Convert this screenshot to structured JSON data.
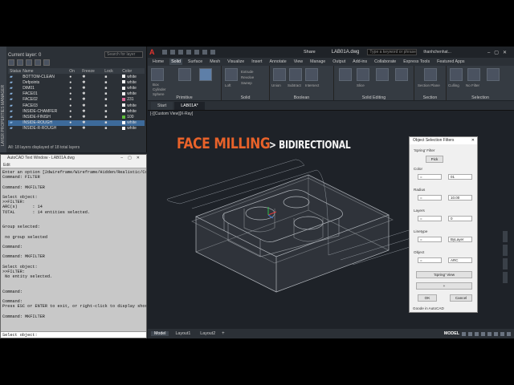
{
  "layers": {
    "panel_label": "LAYER PROPERTIES MANAGER",
    "current_layer": "Current layer: 0",
    "search_placeholder": "Search for layer",
    "columns": [
      "Status",
      "Name",
      "On",
      "Freeze",
      "Lock",
      "Color"
    ],
    "rows": [
      {
        "name": "BOTTOM-CLEAN",
        "color": "white",
        "swatch": "#ffffff"
      },
      {
        "name": "Defpoints",
        "color": "white",
        "swatch": "#ffffff"
      },
      {
        "name": "DIM01",
        "color": "white",
        "swatch": "#ffffff"
      },
      {
        "name": "FACE01",
        "color": "white",
        "swatch": "#ffffff"
      },
      {
        "name": "FACE02",
        "color": "231",
        "swatch": "#e06a9a"
      },
      {
        "name": "FACE03",
        "color": "white",
        "swatch": "#ffffff"
      },
      {
        "name": "INSIDE-CHAMFER",
        "color": "white",
        "swatch": "#ffffff"
      },
      {
        "name": "INSIDE-FINISH",
        "color": "100",
        "swatch": "#5fbf3a"
      },
      {
        "name": "INSIDE-ROUGH",
        "color": "white",
        "swatch": "#ffffff"
      },
      {
        "name": "INSIDE-R-ROUGH",
        "color": "white",
        "swatch": "#ffffff"
      }
    ],
    "footer": "All: 18 layers displayed of 18 total layers"
  },
  "textwin": {
    "title": "AutoCAD Text Window - LAB01A.dwg",
    "menu_edit": "Edit",
    "log": "Enter an option [2dwireframe/Wireframe/Hidden/Realistic/Cor\nCommand: FILTER\n\nCommand: MKFILTER\n\nSelect object:\n>>FILTER:\nARC(s)      : 14\nTOTAL       : 14 entities selected.\n\n\nGroup selected:\n\n no group selected\n\nCommand:\n\nCommand: MKFILTER\n\nSelect object:\n>>FILTER:\n No entity selected.\n\n\nCommand:\n\nCommand:\nPress ESC or ENTER to exit, or right-click to display shor\n\nCommand: MKFILTER\n",
    "prompt": "Select object:"
  },
  "app": {
    "logo": "A",
    "share": "Share",
    "doc_title": "LAB01A.dwg",
    "search_placeholder": "Type a keyword or phrase",
    "user": "thanhchenhat..."
  },
  "ribbon": {
    "tabs": [
      "Home",
      "Solid",
      "Surface",
      "Mesh",
      "Visualize",
      "Insert",
      "Annotate",
      "View",
      "Manage",
      "Output",
      "Add-ins",
      "Collaborate",
      "Express Tools",
      "Featured Apps"
    ],
    "active_tab": "Solid",
    "panels": {
      "primitive": "Primitive",
      "solid": "Solid",
      "boolean": "Boolean",
      "solid_editing": "Solid Editing",
      "section": "Section",
      "selection": "Selection"
    },
    "mini": {
      "box": "Box",
      "cylinder": "Cylinder",
      "sphere": "Sphere",
      "extrude": "Extrude",
      "revolve": "Revolve",
      "sweep": "Sweep",
      "loft": "Loft",
      "union": "Union",
      "subtract": "Subtract",
      "intersect": "Intersect",
      "slice": "Slice",
      "section_plane": "Section Plane",
      "culling": "Culling",
      "no_filter": "No Filter"
    }
  },
  "doctabs": [
    "Start",
    "LAB01A*"
  ],
  "viewport": {
    "label": "[-][Custom View][X-Ray]",
    "headline_main": "FACE MILLING",
    "headline_sub": "> BIDIRECTIONAL"
  },
  "dialog": {
    "title": "Object Selection Filters",
    "spring_filter": "'Spring' Filter",
    "pick": "Pick",
    "color_label": "Color",
    "color_op": "=",
    "color_value": "01",
    "radius_label": "Radius",
    "radius_op": "=",
    "radius_value": "10.00",
    "layers_label": "Layers",
    "layers_op": "=",
    "layers_value": "0",
    "linetype_label": "Linetype",
    "linetype_op": "=",
    "linetype_value": "ByLayer",
    "object_label": "Object",
    "object_op": "=",
    "object_value": "ARC",
    "spring_view": "'Spring' View",
    "plus": "+",
    "ok": "OK",
    "cancel": "Cancel",
    "footer": "Goode in AutoCAD"
  },
  "statusbar": {
    "tabs": [
      "Model",
      "Layout1",
      "Layout2"
    ],
    "active": "Model",
    "plus": "+",
    "model_word": "MODEL"
  }
}
